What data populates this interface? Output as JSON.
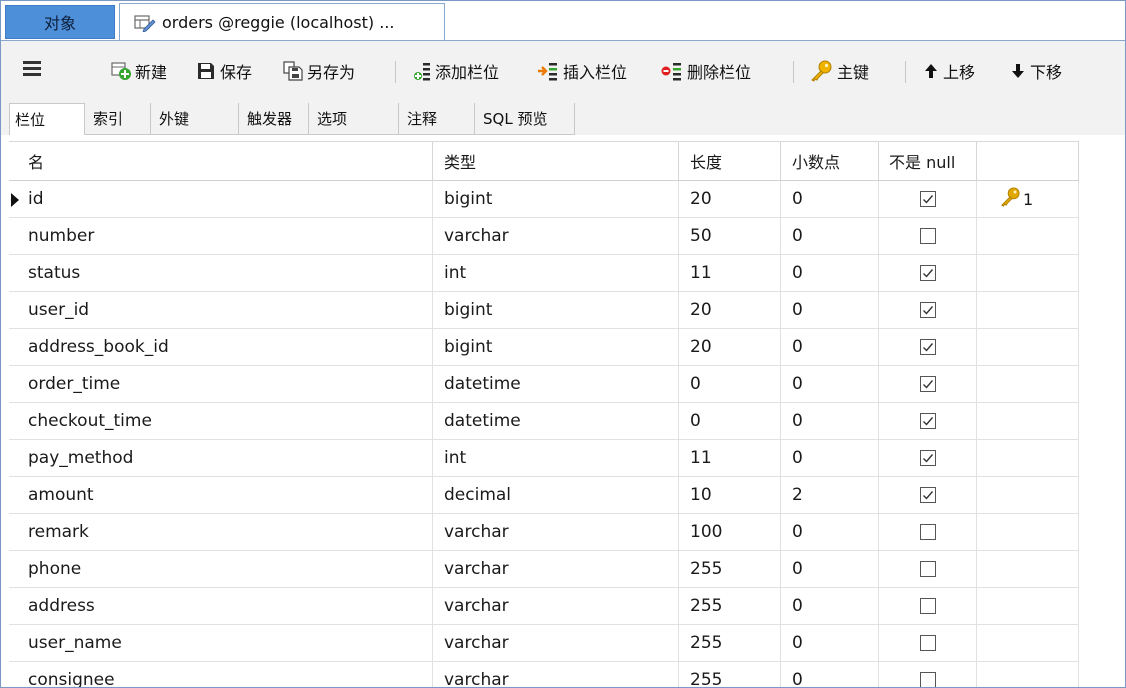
{
  "tabs": {
    "objects": "对象",
    "document": "orders @reggie (localhost) ..."
  },
  "toolbar": {
    "new": "新建",
    "save": "保存",
    "save_as": "另存为",
    "add_field": "添加栏位",
    "insert_field": "插入栏位",
    "delete_field": "删除栏位",
    "primary_key": "主键",
    "move_up": "上移",
    "move_down": "下移"
  },
  "subtabs": [
    "栏位",
    "索引",
    "外键",
    "触发器",
    "选项",
    "注释",
    "SQL 预览"
  ],
  "columns": {
    "name": "名",
    "type": "类型",
    "length": "长度",
    "decimals": "小数点",
    "not_null": "不是 null"
  },
  "rows": [
    {
      "name": "id",
      "type": "bigint",
      "length": "20",
      "decimals": "0",
      "not_null": true,
      "key": "1"
    },
    {
      "name": "number",
      "type": "varchar",
      "length": "50",
      "decimals": "0",
      "not_null": false,
      "key": ""
    },
    {
      "name": "status",
      "type": "int",
      "length": "11",
      "decimals": "0",
      "not_null": true,
      "key": ""
    },
    {
      "name": "user_id",
      "type": "bigint",
      "length": "20",
      "decimals": "0",
      "not_null": true,
      "key": ""
    },
    {
      "name": "address_book_id",
      "type": "bigint",
      "length": "20",
      "decimals": "0",
      "not_null": true,
      "key": ""
    },
    {
      "name": "order_time",
      "type": "datetime",
      "length": "0",
      "decimals": "0",
      "not_null": true,
      "key": ""
    },
    {
      "name": "checkout_time",
      "type": "datetime",
      "length": "0",
      "decimals": "0",
      "not_null": true,
      "key": ""
    },
    {
      "name": "pay_method",
      "type": "int",
      "length": "11",
      "decimals": "0",
      "not_null": true,
      "key": ""
    },
    {
      "name": "amount",
      "type": "decimal",
      "length": "10",
      "decimals": "2",
      "not_null": true,
      "key": ""
    },
    {
      "name": "remark",
      "type": "varchar",
      "length": "100",
      "decimals": "0",
      "not_null": false,
      "key": ""
    },
    {
      "name": "phone",
      "type": "varchar",
      "length": "255",
      "decimals": "0",
      "not_null": false,
      "key": ""
    },
    {
      "name": "address",
      "type": "varchar",
      "length": "255",
      "decimals": "0",
      "not_null": false,
      "key": ""
    },
    {
      "name": "user_name",
      "type": "varchar",
      "length": "255",
      "decimals": "0",
      "not_null": false,
      "key": ""
    },
    {
      "name": "consignee",
      "type": "varchar",
      "length": "255",
      "decimals": "0",
      "not_null": false,
      "key": ""
    }
  ],
  "colors": {
    "active_tab": "#4d8fd8",
    "key_icon": "#e0a800",
    "toolbar_bg": "#f2f2f2"
  },
  "icons": {
    "menu": "hamburger-icon",
    "new": "new-table-icon",
    "save": "save-icon",
    "save_as": "save-as-icon",
    "add_field": "add-field-icon",
    "insert_field": "insert-field-icon",
    "delete_field": "delete-field-icon",
    "primary_key": "key-icon",
    "move_up": "arrow-up-icon",
    "move_down": "arrow-down-icon"
  }
}
